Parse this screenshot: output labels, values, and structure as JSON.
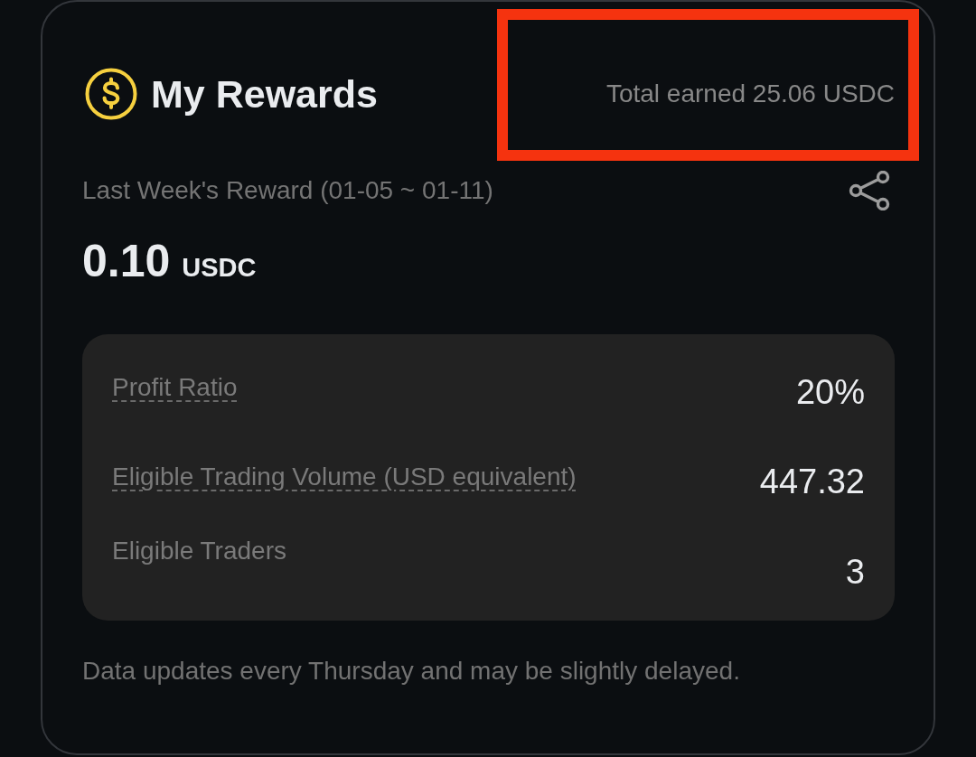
{
  "header": {
    "title": "My Rewards",
    "total_earned": {
      "text": "Total earned 25.06 USDC",
      "highlighted": true
    }
  },
  "last_week": {
    "label": "Last Week's Reward (01-05 ~ 01-11)",
    "amount": "0.10",
    "unit": "USDC"
  },
  "stats": [
    {
      "label": "Profit Ratio",
      "underlined": true,
      "value": "20%"
    },
    {
      "label": "Eligible Trading Volume (USD equivalent)",
      "underlined": true,
      "value": "447.32"
    },
    {
      "label": "Eligible Traders",
      "underlined": false,
      "value": "3"
    }
  ],
  "footnote": "Data updates every Thursday and may be slightly delayed."
}
